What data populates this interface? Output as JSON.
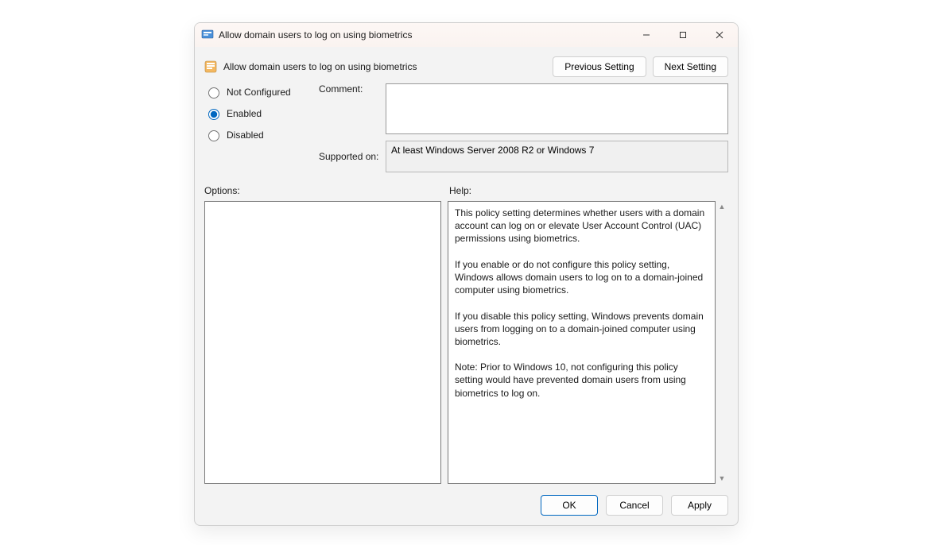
{
  "window": {
    "title": "Allow domain users to log on using biometrics"
  },
  "header": {
    "policy_name": "Allow domain users to log on using biometrics",
    "prev_btn": "Previous Setting",
    "next_btn": "Next Setting"
  },
  "state": {
    "not_configured_label": "Not Configured",
    "enabled_label": "Enabled",
    "disabled_label": "Disabled",
    "selected": "enabled"
  },
  "comment": {
    "label": "Comment:",
    "value": ""
  },
  "supported": {
    "label": "Supported on:",
    "value": "At least Windows Server 2008 R2 or Windows 7"
  },
  "options": {
    "label": "Options:"
  },
  "help": {
    "label": "Help:",
    "text": "This policy setting determines whether users with a domain account can log on or elevate User Account Control (UAC) permissions using biometrics.\n\nIf you enable or do not configure this policy setting, Windows allows domain users to log on to a domain-joined computer using biometrics.\n\nIf you disable this policy setting, Windows prevents domain users from logging on to a domain-joined computer using biometrics.\n\nNote: Prior to Windows 10, not configuring this policy setting would have prevented domain users from using biometrics to log on."
  },
  "footer": {
    "ok": "OK",
    "cancel": "Cancel",
    "apply": "Apply"
  }
}
